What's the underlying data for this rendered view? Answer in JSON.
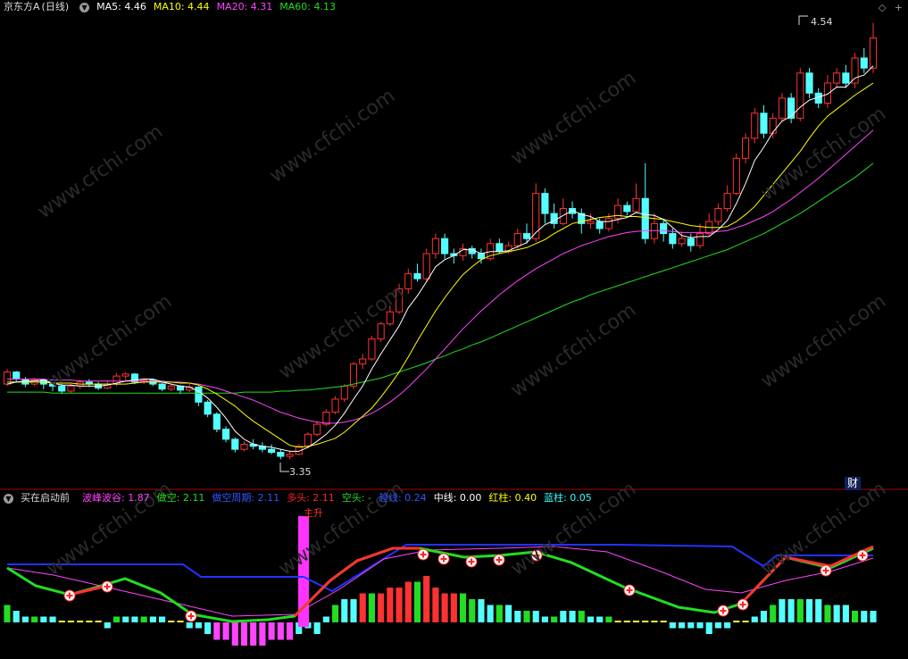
{
  "title": "京东方A",
  "period": "(日线)",
  "ma_header": [
    {
      "label": "MA5: 4.46",
      "color": "#ffffff"
    },
    {
      "label": "MA10: 4.44",
      "color": "#ffff00"
    },
    {
      "label": "MA20: 4.31",
      "color": "#ff44ff"
    },
    {
      "label": "MA60: 4.13",
      "color": "#22dd22"
    }
  ],
  "indicator": {
    "name": "买在启动前",
    "items": [
      {
        "label": "波峰波谷: 1.87",
        "color": "#ff44ff"
      },
      {
        "label": "做空: 2.11",
        "color": "#22dd22"
      },
      {
        "label": "做空周期: 2.11",
        "color": "#3355ff"
      },
      {
        "label": "多头: 2.11",
        "color": "#ff2222"
      },
      {
        "label": "空头: -",
        "color": "#22dd22"
      },
      {
        "label": "趋线: 0.24",
        "color": "#3355ff"
      },
      {
        "label": "中线: 0.00",
        "color": "#ffffff"
      },
      {
        "label": "红柱: 0.40",
        "color": "#ffff00"
      },
      {
        "label": "蓝柱: 0.05",
        "color": "#33ffff"
      }
    ]
  },
  "price_high_label": "4.54",
  "price_low_label": "3.35",
  "finance_button": "财",
  "signal_label": "主升",
  "watermark": "www.cfchi.com",
  "colors": {
    "up": "#ff3232",
    "down": "#54ffff",
    "ma5": "#ffffff",
    "ma10": "#ffff00",
    "ma20": "#ff44ff",
    "ma60": "#22dd22",
    "divider": "#aa0000"
  },
  "chart_data": {
    "type": "candlestick",
    "candles": [
      [
        4.1,
        4.22,
        4.25,
        4.08
      ],
      [
        4.22,
        4.15,
        4.23,
        4.12
      ],
      [
        4.15,
        4.1,
        4.17,
        4.07
      ],
      [
        4.1,
        4.14,
        4.16,
        4.08
      ],
      [
        4.14,
        4.1,
        4.15,
        4.05
      ],
      [
        4.1,
        4.08,
        4.12,
        4.03
      ],
      [
        4.08,
        4.03,
        4.1,
        4.0
      ],
      [
        4.03,
        4.08,
        4.1,
        4.01
      ],
      [
        4.08,
        4.12,
        4.14,
        4.05
      ],
      [
        4.12,
        4.1,
        4.15,
        4.07
      ],
      [
        4.1,
        4.06,
        4.12,
        4.04
      ],
      [
        4.06,
        4.1,
        4.13,
        4.05
      ],
      [
        4.1,
        4.18,
        4.21,
        4.08
      ],
      [
        4.18,
        4.2,
        4.22,
        4.14
      ],
      [
        4.2,
        4.12,
        4.21,
        4.1
      ],
      [
        4.12,
        4.14,
        4.16,
        4.1
      ],
      [
        4.14,
        4.1,
        4.15,
        4.08
      ],
      [
        4.1,
        4.05,
        4.11,
        4.03
      ],
      [
        4.05,
        4.08,
        4.1,
        4.03
      ],
      [
        4.08,
        4.04,
        4.09,
        4.0
      ],
      [
        4.04,
        4.07,
        4.1,
        4.02
      ],
      [
        4.07,
        3.92,
        4.08,
        3.88
      ],
      [
        3.92,
        3.8,
        3.94,
        3.77
      ],
      [
        3.8,
        3.65,
        3.82,
        3.62
      ],
      [
        3.65,
        3.55,
        3.68,
        3.52
      ],
      [
        3.55,
        3.45,
        3.57,
        3.42
      ],
      [
        3.45,
        3.5,
        3.53,
        3.43
      ],
      [
        3.5,
        3.48,
        3.55,
        3.45
      ],
      [
        3.48,
        3.45,
        3.52,
        3.42
      ],
      [
        3.45,
        3.42,
        3.5,
        3.4
      ],
      [
        3.42,
        3.38,
        3.45,
        3.35
      ],
      [
        3.38,
        3.4,
        3.43,
        3.35
      ],
      [
        3.4,
        3.48,
        3.5,
        3.39
      ],
      [
        3.48,
        3.6,
        3.62,
        3.46
      ],
      [
        3.6,
        3.7,
        3.73,
        3.58
      ],
      [
        3.7,
        3.82,
        3.85,
        3.68
      ],
      [
        3.82,
        3.95,
        3.98,
        3.8
      ],
      [
        3.95,
        4.08,
        4.1,
        3.92
      ],
      [
        4.08,
        4.3,
        4.32,
        4.05
      ],
      [
        4.3,
        4.35,
        4.4,
        4.25
      ],
      [
        4.35,
        4.55,
        4.58,
        4.33
      ],
      [
        4.55,
        4.7,
        4.72,
        4.52
      ],
      [
        4.7,
        4.82,
        4.88,
        4.68
      ],
      [
        4.82,
        5.05,
        5.1,
        4.8
      ],
      [
        5.05,
        5.2,
        5.25,
        5.0
      ],
      [
        5.2,
        5.15,
        5.3,
        5.12
      ],
      [
        5.15,
        5.4,
        5.45,
        5.12
      ],
      [
        5.4,
        5.55,
        5.6,
        5.35
      ],
      [
        5.55,
        5.4,
        5.6,
        5.35
      ],
      [
        5.4,
        5.38,
        5.45,
        5.3
      ],
      [
        5.38,
        5.45,
        5.5,
        5.33
      ],
      [
        5.45,
        5.4,
        5.48,
        5.35
      ],
      [
        5.4,
        5.35,
        5.45,
        5.3
      ],
      [
        5.35,
        5.5,
        5.55,
        5.33
      ],
      [
        5.5,
        5.42,
        5.55,
        5.4
      ],
      [
        5.42,
        5.48,
        5.52,
        5.4
      ],
      [
        5.48,
        5.6,
        5.65,
        5.45
      ],
      [
        5.6,
        5.55,
        5.7,
        5.5
      ],
      [
        5.55,
        6.0,
        6.1,
        5.52
      ],
      [
        6.0,
        5.8,
        6.05,
        5.7
      ],
      [
        5.8,
        5.7,
        5.9,
        5.65
      ],
      [
        5.7,
        5.85,
        5.95,
        5.68
      ],
      [
        5.85,
        5.8,
        5.92,
        5.75
      ],
      [
        5.8,
        5.7,
        5.85,
        5.6
      ],
      [
        5.7,
        5.72,
        5.8,
        5.65
      ],
      [
        5.72,
        5.65,
        5.75,
        5.6
      ],
      [
        5.65,
        5.75,
        5.8,
        5.62
      ],
      [
        5.75,
        5.88,
        5.95,
        5.7
      ],
      [
        5.88,
        5.82,
        5.92,
        5.78
      ],
      [
        5.82,
        5.95,
        6.1,
        5.8
      ],
      [
        5.95,
        5.55,
        6.3,
        5.5
      ],
      [
        5.55,
        5.7,
        5.8,
        5.5
      ],
      [
        5.7,
        5.6,
        5.75,
        5.52
      ],
      [
        5.6,
        5.5,
        5.65,
        5.45
      ],
      [
        5.5,
        5.55,
        5.62,
        5.47
      ],
      [
        5.55,
        5.48,
        5.6,
        5.42
      ],
      [
        5.48,
        5.6,
        5.7,
        5.45
      ],
      [
        5.6,
        5.72,
        5.8,
        5.58
      ],
      [
        5.72,
        5.85,
        5.9,
        5.68
      ],
      [
        5.85,
        6.0,
        6.08,
        5.82
      ],
      [
        6.0,
        6.35,
        6.4,
        5.98
      ],
      [
        6.35,
        6.55,
        6.6,
        6.3
      ],
      [
        6.55,
        6.8,
        6.85,
        6.5
      ],
      [
        6.8,
        6.6,
        6.88,
        6.55
      ],
      [
        6.6,
        6.75,
        6.8,
        6.55
      ],
      [
        6.75,
        6.95,
        7.0,
        6.72
      ],
      [
        6.95,
        6.75,
        7.0,
        6.7
      ],
      [
        6.75,
        7.2,
        7.25,
        6.72
      ],
      [
        7.2,
        7.0,
        7.25,
        6.95
      ],
      [
        7.0,
        6.9,
        7.05,
        6.85
      ],
      [
        6.9,
        7.1,
        7.18,
        6.85
      ],
      [
        7.1,
        7.2,
        7.25,
        7.05
      ],
      [
        7.2,
        7.1,
        7.28,
        7.05
      ],
      [
        7.1,
        7.35,
        7.4,
        7.05
      ],
      [
        7.35,
        7.25,
        7.45,
        7.2
      ],
      [
        7.25,
        7.55,
        7.7,
        7.2
      ]
    ],
    "ma5": [
      4.1,
      4.12,
      4.13,
      4.13,
      4.14,
      4.11,
      4.09,
      4.09,
      4.08,
      4.08,
      4.08,
      4.09,
      4.11,
      4.13,
      4.14,
      4.15,
      4.15,
      4.12,
      4.1,
      4.08,
      4.07,
      4.03,
      3.96,
      3.87,
      3.76,
      3.63,
      3.55,
      3.5,
      3.48,
      3.47,
      3.45,
      3.43,
      3.43,
      3.47,
      3.53,
      3.6,
      3.69,
      3.81,
      3.95,
      4.08,
      4.25,
      4.4,
      4.54,
      4.68,
      4.86,
      4.98,
      5.12,
      5.27,
      5.34,
      5.38,
      5.44,
      5.44,
      5.4,
      5.42,
      5.42,
      5.43,
      5.47,
      5.51,
      5.61,
      5.69,
      5.73,
      5.78,
      5.83,
      5.79,
      5.77,
      5.72,
      5.72,
      5.74,
      5.76,
      5.81,
      5.79,
      5.78,
      5.74,
      5.66,
      5.58,
      5.56,
      5.57,
      5.57,
      5.64,
      5.73,
      5.9,
      6.1,
      6.33,
      6.46,
      6.61,
      6.72,
      6.77,
      6.86,
      6.93,
      6.96,
      6.99,
      7.06,
      7.06,
      7.15,
      7.18,
      7.27
    ],
    "ma10": [
      4.12,
      4.12,
      4.12,
      4.12,
      4.12,
      4.11,
      4.11,
      4.11,
      4.1,
      4.1,
      4.1,
      4.1,
      4.1,
      4.1,
      4.11,
      4.12,
      4.12,
      4.12,
      4.12,
      4.11,
      4.11,
      4.09,
      4.05,
      4.0,
      3.94,
      3.88,
      3.8,
      3.73,
      3.67,
      3.61,
      3.55,
      3.49,
      3.47,
      3.48,
      3.5,
      3.53,
      3.56,
      3.62,
      3.7,
      3.78,
      3.86,
      3.97,
      4.09,
      4.22,
      4.37,
      4.53,
      4.68,
      4.83,
      4.96,
      5.08,
      5.19,
      5.27,
      5.34,
      5.38,
      5.4,
      5.42,
      5.44,
      5.46,
      5.5,
      5.54,
      5.6,
      5.65,
      5.7,
      5.72,
      5.74,
      5.76,
      5.77,
      5.78,
      5.77,
      5.77,
      5.76,
      5.75,
      5.74,
      5.72,
      5.7,
      5.68,
      5.67,
      5.66,
      5.66,
      5.67,
      5.72,
      5.79,
      5.87,
      5.98,
      6.09,
      6.2,
      6.31,
      6.42,
      6.55,
      6.67,
      6.77,
      6.84,
      6.91,
      6.98,
      7.04,
      7.1
    ],
    "ma20": [
      4.15,
      4.15,
      4.15,
      4.15,
      4.15,
      4.14,
      4.14,
      4.14,
      4.13,
      4.13,
      4.13,
      4.13,
      4.13,
      4.13,
      4.13,
      4.13,
      4.13,
      4.13,
      4.12,
      4.12,
      4.11,
      4.1,
      4.08,
      4.06,
      4.03,
      4.0,
      3.97,
      3.94,
      3.9,
      3.86,
      3.82,
      3.79,
      3.76,
      3.74,
      3.72,
      3.71,
      3.71,
      3.72,
      3.74,
      3.77,
      3.81,
      3.86,
      3.92,
      3.99,
      4.07,
      4.16,
      4.25,
      4.35,
      4.45,
      4.55,
      4.65,
      4.74,
      4.83,
      4.91,
      4.99,
      5.06,
      5.13,
      5.19,
      5.25,
      5.3,
      5.35,
      5.4,
      5.44,
      5.48,
      5.51,
      5.54,
      5.57,
      5.59,
      5.61,
      5.62,
      5.63,
      5.63,
      5.63,
      5.62,
      5.61,
      5.61,
      5.61,
      5.61,
      5.62,
      5.63,
      5.66,
      5.69,
      5.73,
      5.77,
      5.82,
      5.88,
      5.94,
      6.01,
      6.08,
      6.15,
      6.23,
      6.31,
      6.39,
      6.47,
      6.55,
      6.63
    ],
    "ma60": [
      4.02,
      4.02,
      4.02,
      4.02,
      4.02,
      4.01,
      4.01,
      4.01,
      4.01,
      4.01,
      4.01,
      4.01,
      4.01,
      4.01,
      4.01,
      4.01,
      4.01,
      4.01,
      4.01,
      4.01,
      4.01,
      4.01,
      4.01,
      4.01,
      4.01,
      4.01,
      4.02,
      4.02,
      4.02,
      4.02,
      4.03,
      4.03,
      4.04,
      4.04,
      4.05,
      4.06,
      4.07,
      4.08,
      4.1,
      4.12,
      4.14,
      4.16,
      4.19,
      4.22,
      4.25,
      4.28,
      4.31,
      4.35,
      4.38,
      4.42,
      4.45,
      4.49,
      4.52,
      4.56,
      4.6,
      4.64,
      4.68,
      4.72,
      4.76,
      4.8,
      4.84,
      4.88,
      4.92,
      4.95,
      4.99,
      5.02,
      5.05,
      5.08,
      5.11,
      5.14,
      5.17,
      5.2,
      5.23,
      5.26,
      5.29,
      5.32,
      5.35,
      5.38,
      5.41,
      5.44,
      5.48,
      5.52,
      5.56,
      5.6,
      5.65,
      5.7,
      5.75,
      5.8,
      5.86,
      5.92,
      5.98,
      6.04,
      6.1,
      6.16,
      6.23,
      6.3
    ],
    "indicator_bars": [
      3,
      2,
      1,
      1,
      1,
      1,
      0,
      0,
      0,
      0,
      0,
      -1,
      1,
      1,
      1,
      1,
      1,
      1,
      0,
      0,
      -1,
      -1,
      -2,
      -3,
      -3,
      -4,
      -4,
      -4,
      -4,
      -3,
      -3,
      -3,
      -2,
      -1,
      -2,
      1,
      3,
      4,
      4,
      5,
      5,
      5,
      6,
      6,
      7,
      7,
      8,
      6,
      5,
      5,
      5,
      4,
      4,
      3,
      3,
      3,
      2,
      2,
      2,
      1,
      1,
      2,
      2,
      2,
      1,
      1,
      1,
      0,
      0,
      0,
      0,
      0,
      0,
      -1,
      -1,
      -1,
      -1,
      -2,
      -1,
      -1,
      0,
      0,
      1,
      2,
      3,
      4,
      4,
      4,
      4,
      4,
      3,
      3,
      3,
      2,
      2,
      2
    ]
  }
}
